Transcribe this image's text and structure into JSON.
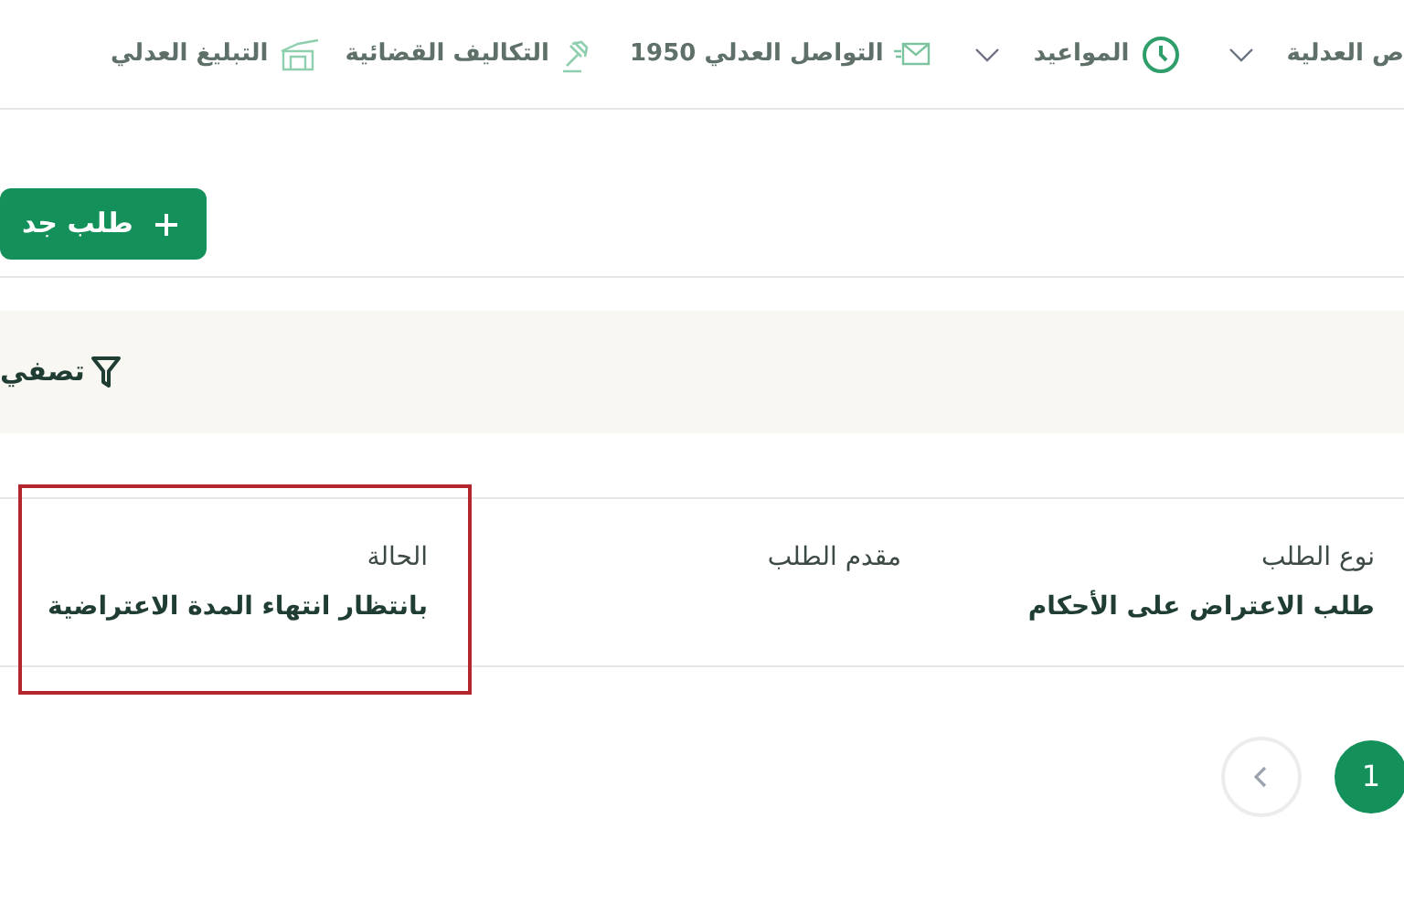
{
  "nav": {
    "items": [
      {
        "label": "ص العدلية",
        "has_dropdown": true
      },
      {
        "label": "المواعيد",
        "has_dropdown": true
      },
      {
        "label": "التواصل العدلي 1950",
        "has_dropdown": false
      },
      {
        "label": "التكاليف القضائية",
        "has_dropdown": false
      },
      {
        "label": "التبليغ العدلي",
        "has_dropdown": false
      }
    ]
  },
  "new_request_button": {
    "label": "طلب جد"
  },
  "filter": {
    "label": "تصفي"
  },
  "table": {
    "columns": [
      "نوع الطلب",
      "مقدم الطلب",
      "الحالة"
    ],
    "rows": [
      {
        "cells": [
          {
            "text": "طلب الاعتراض على الأحكام",
            "highlighted": false
          },
          {
            "highlighted": false
          },
          {
            "text": "بانتظار انتهاء المدة الاعتراضية",
            "highlighted": true
          }
        ]
      }
    ]
  },
  "pagination": {
    "pages": [
      {
        "label": "1",
        "selected": true
      }
    ]
  }
}
